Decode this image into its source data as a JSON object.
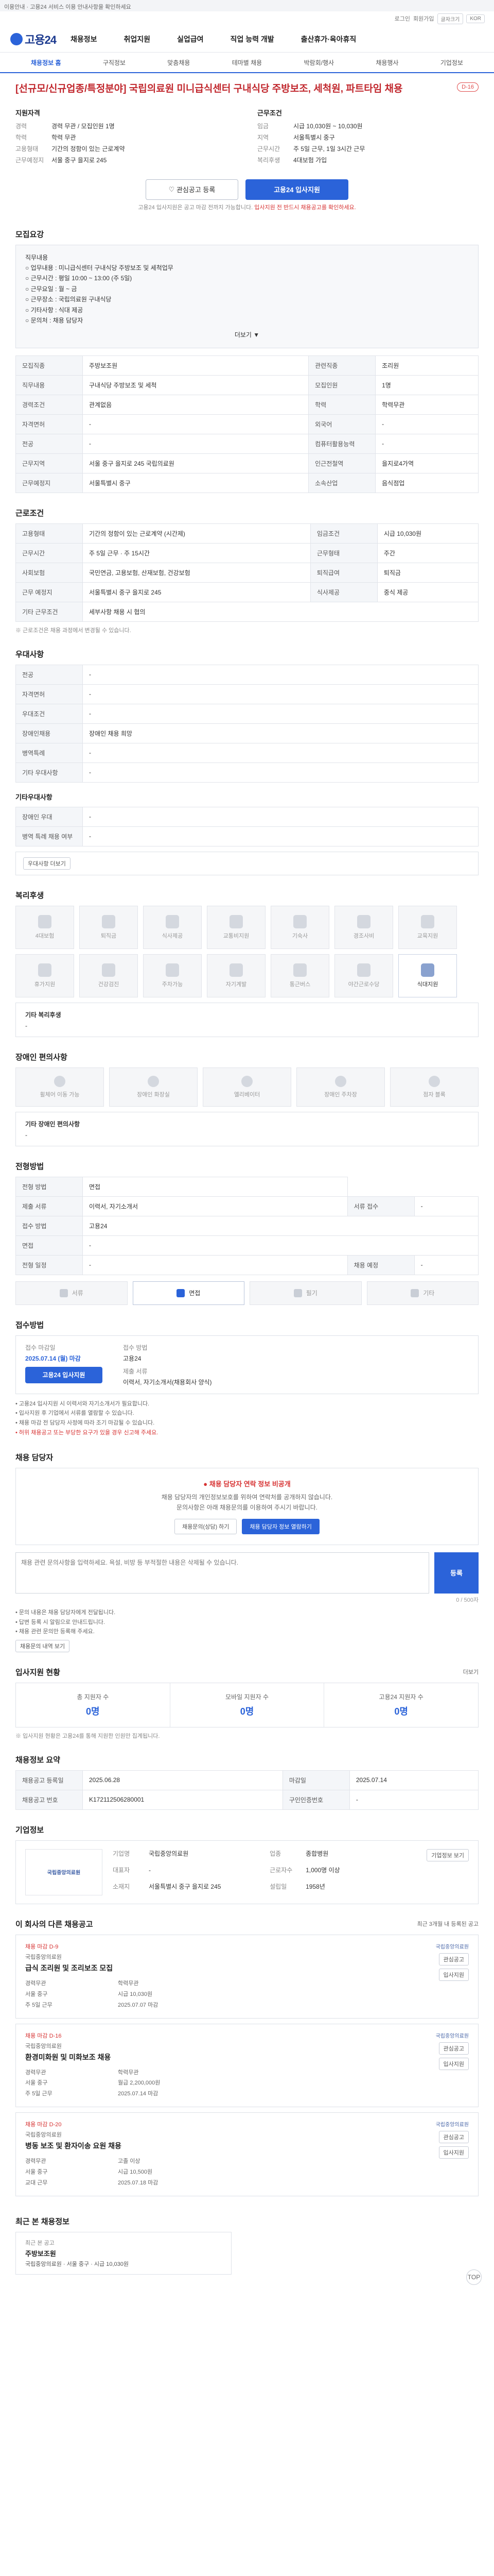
{
  "top_notice": "이용안내 · 고용24 서비스 이용 안내사항을 확인하세요",
  "util": {
    "login": "로그인",
    "signup": "회원가입",
    "size_btn": "글자크기",
    "lang": "KOR"
  },
  "header": {
    "logo": "고용24",
    "gnb": [
      "채용정보",
      "취업지원",
      "실업급여",
      "직업 능력 개발",
      "출산휴가·육아휴직"
    ]
  },
  "sub_tabs": [
    "채용정보 홈",
    "구직정보",
    "맞춤채용",
    "테마별 채용",
    "박람회/행사",
    "채용행사",
    "기업정보"
  ],
  "job": {
    "title": "[선규모/신규업종/특정분야] 국립의료원 미니급식센터 구내식당 주방보조, 세척원, 파트타임 채용",
    "badge": "D-16"
  },
  "summary": {
    "left_title": "지원자격",
    "left": [
      {
        "k": "경력",
        "v": "경력 무관 / 모집인원 1명"
      },
      {
        "k": "학력",
        "v": "학력 무관"
      },
      {
        "k": "고용형태",
        "v": "기간의 정함이 있는 근로계약"
      },
      {
        "k": "근무예정지",
        "v": "서울 중구 을지로 245"
      }
    ],
    "right_title": "근무조건",
    "right": [
      {
        "k": "임금",
        "v": "시급 10,030원 ~ 10,030원"
      },
      {
        "k": "지역",
        "v": "서울특별시 중구"
      },
      {
        "k": "근무시간",
        "v": "주 5일 근무, 1일 3시간 근무"
      },
      {
        "k": "복리후생",
        "v": "4대보험 가입"
      }
    ]
  },
  "actions": {
    "interest": "관심공고 등록",
    "apply": "고용24 입사지원",
    "note": "고용24 입사지원은 공고 마감 전까지 가능합니다.",
    "note_red": "입사지원 전 반드시 채용공고를 확인하세요."
  },
  "sections": {
    "job_content": "모집요강",
    "conditions": "근로조건",
    "preference": "우대사항",
    "welfare": "복리후생",
    "disability": "장애인 편의사항",
    "selection": "전형방법",
    "apply": "접수방법",
    "inquiry": "채용 담당자",
    "stats": "입사지원 현황",
    "info": "채용정보 요약",
    "company": "기업정보",
    "similar": "이 회사의 다른 채용공고",
    "recent": "최근 본 채용정보"
  },
  "content_lines": [
    "직무내용",
    "○ 업무내용 : 미니급식센터 구내식당 주방보조 및 세척업무",
    "○ 근무시간 : 평일 10:00 ~ 13:00 (주 5일)",
    "○ 근무요일 : 월 ~ 금",
    "○ 근무장소 : 국립의료원 구내식당",
    "○ 기타사항 : 식대 제공",
    "○ 문의처 : 채용 담당자"
  ],
  "fold_label": "더보기 ▼",
  "recruit_table": [
    {
      "k": "모집직종",
      "v": "주방보조원",
      "k2": "관련직종",
      "v2": "조리원"
    },
    {
      "k": "직무내용",
      "v": "구내식당 주방보조 및 세척",
      "k2": "모집인원",
      "v2": "1명"
    },
    {
      "k": "경력조건",
      "v": "관계없음",
      "k2": "학력",
      "v2": "학력무관"
    },
    {
      "k": "자격면허",
      "v": "-",
      "k2": "외국어",
      "v2": "-"
    },
    {
      "k": "전공",
      "v": "-",
      "k2": "컴퓨터활용능력",
      "v2": "-"
    },
    {
      "k": "근무지역",
      "v": "서울 중구 을지로 245 국립의료원",
      "k2": "인근전철역",
      "v2": "을지로4가역"
    },
    {
      "k": "근무예정지",
      "v": "서울특별시 중구",
      "k2": "소속산업",
      "v2": "음식점업"
    }
  ],
  "cond_table": [
    {
      "k": "고용형태",
      "v": "기간의 정함이 있는 근로계약 (시간제)",
      "k2": "임금조건",
      "v2": "시급 10,030원"
    },
    {
      "k": "근무시간",
      "v": "주 5일 근무 · 주 15시간",
      "k2": "근무형태",
      "v2": "주간"
    },
    {
      "k": "사회보험",
      "v": "국민연금, 고용보험, 산재보험, 건강보험",
      "k2": "퇴직급여",
      "v2": "퇴직금"
    },
    {
      "k": "근무 예정지",
      "v": "서울특별시 중구 을지로 245",
      "k2": "식사제공",
      "v2": "중식 제공"
    },
    {
      "k": "기타 근무조건",
      "v": "세부사항 채용 시 협의",
      "k2": "",
      "v2": ""
    }
  ],
  "cond_note": "※ 근로조건은 채용 과정에서 변경될 수 있습니다.",
  "pref_table": [
    {
      "k": "전공",
      "v": "-"
    },
    {
      "k": "자격면허",
      "v": "-"
    },
    {
      "k": "우대조건",
      "v": "-"
    },
    {
      "k": "장애인채용",
      "v": "장애인 채용 희망"
    },
    {
      "k": "병역특례",
      "v": "-"
    },
    {
      "k": "기타 우대사항",
      "v": "-"
    }
  ],
  "pref2_title": "기타우대사항",
  "pref2_table": [
    {
      "k": "장애인 우대",
      "v": "-"
    },
    {
      "k": "병역 특례 채용 여부",
      "v": "-"
    }
  ],
  "pref_more": "우대사항 더보기",
  "welfare_items": [
    {
      "label": "4대보험",
      "on": false
    },
    {
      "label": "퇴직금",
      "on": false
    },
    {
      "label": "식사제공",
      "on": false
    },
    {
      "label": "교통비지원",
      "on": false
    },
    {
      "label": "기숙사",
      "on": false
    },
    {
      "label": "경조사비",
      "on": false
    },
    {
      "label": "교육지원",
      "on": false
    },
    {
      "label": "휴가지원",
      "on": false
    },
    {
      "label": "건강검진",
      "on": false
    },
    {
      "label": "주차가능",
      "on": false
    },
    {
      "label": "자기계발",
      "on": false
    },
    {
      "label": "통근버스",
      "on": false
    },
    {
      "label": "야간근로수당",
      "on": false
    },
    {
      "label": "식대지원",
      "on": true
    }
  ],
  "welfare_etc_title": "기타 복리후생",
  "welfare_etc": "-",
  "dis_items": [
    "휠체어 이동 가능",
    "장애인 화장실",
    "엘리베이터",
    "장애인 주차장",
    "점자 블록"
  ],
  "dis_etc_title": "기타 장애인 편의사항",
  "dis_etc": "-",
  "sel_table": [
    {
      "k": "전형 방법",
      "v": "면접"
    },
    {
      "k": "제출 서류",
      "v": "이력서, 자기소개서",
      "k2": "서류 접수",
      "v2": "-"
    },
    {
      "k": "접수 방법",
      "v": "고용24",
      "k2": "",
      "v2": ""
    },
    {
      "k": "면접",
      "v": "-",
      "k2": "",
      "v2": ""
    },
    {
      "k": "전형 일정",
      "v": "-",
      "k2": "채용 예정",
      "v2": "-"
    }
  ],
  "methods": [
    {
      "label": "서류",
      "on": false
    },
    {
      "label": "면접",
      "on": true
    },
    {
      "label": "필기",
      "on": false
    },
    {
      "label": "기타",
      "on": false
    }
  ],
  "apply_info": {
    "l1": "접수 마감일",
    "v1": "2025.07.14 (월) 마감",
    "l2": "접수 방법",
    "v2": "고용24",
    "l3": "제출 서류",
    "v3": "이력서, 자기소개서(채용회사 양식)",
    "btn": "고용24 입사지원"
  },
  "apply_bullets": [
    "• 고용24 입사지원 시 이력서와 자기소개서가 필요합니다.",
    "• 입사지원 후 기업에서 서류를 열람할 수 있습니다.",
    "• 채용 마감 전 담당자 사정에 따라 조기 마감될 수 있습니다."
  ],
  "apply_bullets_red": "• 허위 채용공고 또는 부당한 요구가 있을 경우 신고해 주세요.",
  "inquiry": {
    "alert": "채용 담당자 연락 정보 비공개",
    "desc1": "채용 담당자의 개인정보보호를 위하여 연락처를 공개하지 않습니다.",
    "desc2": "문의사항은 아래 채용문의를 이용하여 주시기 바랍니다.",
    "btn1": "채용문의(상담) 하기",
    "btn2": "채용 담당자 정보 열람하기",
    "qa_placeholder": "채용 관련 문의사항을 입력하세요. 욕설, 비방 등 부적절한 내용은 삭제될 수 있습니다.",
    "qa_btn": "등록",
    "qa_count": "0 / 500자"
  },
  "inq_notes": [
    "• 문의 내용은 채용 담당자에게 전달됩니다.",
    "• 답변 등록 시 알림으로 안내드립니다.",
    "• 채용 관련 문의만 등록해 주세요."
  ],
  "inq_more": "채용문의 내역 보기",
  "stats_more": "더보기",
  "stats": [
    {
      "l": "총 지원자 수",
      "n": "0명"
    },
    {
      "l": "모바일 지원자 수",
      "n": "0명"
    },
    {
      "l": "고용24 지원자 수",
      "n": "0명"
    }
  ],
  "stats_note": "※ 입사지원 현황은 고용24를 통해 지원한 인원만 집계됩니다.",
  "info_table": [
    {
      "k": "채용공고 등록일",
      "v": "2025.06.28",
      "k2": "마감일",
      "v2": "2025.07.14"
    },
    {
      "k": "채용공고 번호",
      "v": "K172112506280001",
      "k2": "구인인증번호",
      "v2": "-"
    }
  ],
  "company": {
    "logo_text": "국립중앙의료원",
    "btn": "기업정보 보기",
    "rows": [
      {
        "k": "기업명",
        "v": "국립중앙의료원"
      },
      {
        "k": "업종",
        "v": "종합병원"
      },
      {
        "k": "대표자",
        "v": "-"
      },
      {
        "k": "근로자수",
        "v": "1,000명 이상"
      },
      {
        "k": "소재지",
        "v": "서울특별시 중구 을지로 245"
      },
      {
        "k": "설립일",
        "v": "1958년"
      }
    ]
  },
  "similar_more": "최근 3개월 내 등록된 공고",
  "cards": [
    {
      "tag": "채용 마감 D-9",
      "co": "국립중앙의료원",
      "ttl": "급식 조리원 및 조리보조 모집",
      "meta": [
        "경력무관",
        "학력무관",
        "서울 중구",
        "시급 10,030원",
        "주 5일 근무",
        "2025.07.07 마감"
      ],
      "logo": "국립중앙의료원",
      "b1": "관심공고",
      "b2": "입사지원"
    },
    {
      "tag": "채용 마감 D-16",
      "co": "국립중앙의료원",
      "ttl": "환경미화원 및 미화보조 채용",
      "meta": [
        "경력무관",
        "학력무관",
        "서울 중구",
        "월급 2,200,000원",
        "주 5일 근무",
        "2025.07.14 마감"
      ],
      "logo": "국립중앙의료원",
      "b1": "관심공고",
      "b2": "입사지원"
    },
    {
      "tag": "채용 마감 D-20",
      "co": "국립중앙의료원",
      "ttl": "병동 보조 및 환자이송 요원 채용",
      "meta": [
        "경력무관",
        "고졸 이상",
        "서울 중구",
        "시급 10,500원",
        "교대 근무",
        "2025.07.18 마감"
      ],
      "logo": "국립중앙의료원",
      "b1": "관심공고",
      "b2": "입사지원"
    }
  ],
  "recent": {
    "cat": "최근 본 공고",
    "nm": "주방보조원",
    "ds": "국립중앙의료원 · 서울 중구 · 시급 10,030원"
  },
  "top_btn": "TOP"
}
